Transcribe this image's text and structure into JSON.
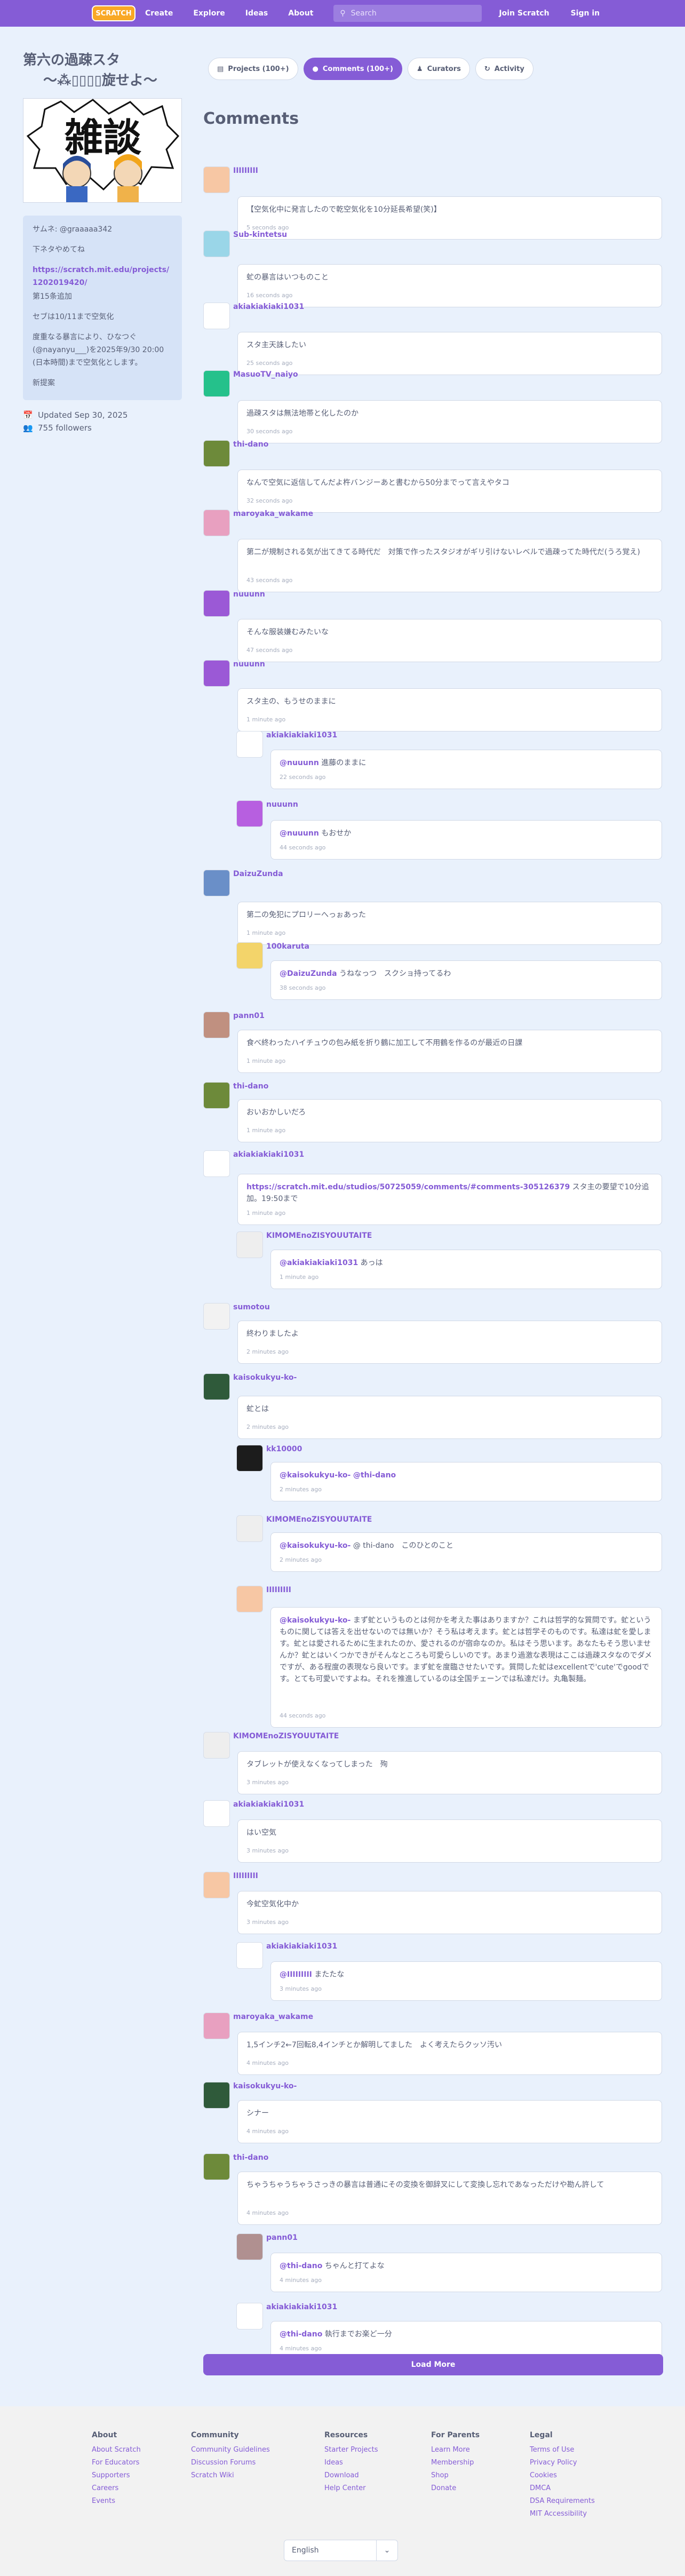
{
  "nav": {
    "logo": "SCRATCH",
    "create": "Create",
    "explore": "Explore",
    "ideas": "Ideas",
    "about": "About",
    "search_placeholder": "Search",
    "join": "Join Scratch",
    "signin": "Sign in"
  },
  "studio": {
    "title_line1": "第六の過疎スタ",
    "title_line2": "〜⁂▯▯▯▯旋せよ〜",
    "thumb_text": "雑談",
    "desc": [
      "サムネ: @graaaaa342",
      "下ネタやめてね",
      "https://scratch.mit.edu/projects/1202019420/",
      "第15条追加",
      "セブは10/11まで空気化",
      "度重なる暴言により、ひなつぐ(@nayanyu___)を2025年9/30 20:00 (日本時間)まで空気化とします。",
      "新提案"
    ],
    "updated": "Updated Sep 30, 2025",
    "followers": "755 followers"
  },
  "tabs": [
    {
      "label": "Projects (100+)",
      "icon": "projects-icon"
    },
    {
      "label": "Comments (100+)",
      "icon": "comments-icon"
    },
    {
      "label": "Curators",
      "icon": "curators-icon"
    },
    {
      "label": "Activity",
      "icon": "activity-icon"
    }
  ],
  "comments_heading": "Comments",
  "comments": [
    {
      "user": "IIIIIIIII",
      "text": "【空気化中に発言したので乾空気化を10分延長希望(笑)】",
      "time": "5 seconds ago",
      "reply": false
    },
    {
      "user": "Sub-kintetsu",
      "text": "虻の暴言はいつものこと",
      "time": "16 seconds ago",
      "reply": false
    },
    {
      "user": "akiakiakiaki1031",
      "text": "スタ主天誅したい",
      "time": "25 seconds ago",
      "reply": false
    },
    {
      "user": "MasuoTV_naiyo",
      "text": "過疎スタは無法地帯と化したのか",
      "time": "30 seconds ago",
      "reply": false
    },
    {
      "user": "thi-dano",
      "text": "なんで空気に返信してんだよ杵バンジーあと書むから50分までって言えやタコ",
      "time": "32 seconds ago",
      "reply": false
    },
    {
      "user": "maroyaka_wakame",
      "text": "第二が規制される気が出てきてる時代だ　対策で作ったスタジオがギリ引けないレベルで過疎ってた時代だ(うろ覚え)",
      "time": "43 seconds ago",
      "reply": false
    },
    {
      "user": "nuuunn",
      "text": "そんな服装嫌むみたいな",
      "time": "47 seconds ago",
      "reply": false
    },
    {
      "user": "nuuunn",
      "text": "スタ主の、もうせのままに",
      "time": "1 minute ago",
      "reply": false
    },
    {
      "user": "akiakiakiaki1031",
      "mention": "@nuuunn",
      "text": " 進藤のままに",
      "time": "22 seconds ago",
      "reply": true
    },
    {
      "user": "nuuunn",
      "mention": "@nuuunn",
      "text": " もおせか",
      "time": "44 seconds ago",
      "reply": true
    },
    {
      "user": "DaizuZunda",
      "text": "第二の免犯にプロリーへっぉあった",
      "time": "1 minute ago",
      "reply": false
    },
    {
      "user": "100karuta",
      "mention": "@DaizuZunda",
      "text": " うねなっつ　スクショ持ってるわ",
      "time": "38 seconds ago",
      "reply": true
    },
    {
      "user": "pann01",
      "text": "食べ終わったハイチュウの包み紙を折り鶴に加工して不用鶴を作るのが最近の日課",
      "time": "1 minute ago",
      "reply": false
    },
    {
      "user": "thi-dano",
      "text": "おいおかしいだろ",
      "time": "1 minute ago",
      "reply": false
    },
    {
      "user": "akiakiakiaki1031",
      "link": "https://scratch.mit.edu/studios/50725059/comments/#comments-305126379",
      "text": " スタ主の要望で10分追加。19:50まで",
      "time": "1 minute ago",
      "reply": false
    },
    {
      "user": "KIMOMEnoZISYOUUTAITE",
      "mention": "@akiakiakiaki1031",
      "text": " あっは",
      "time": "1 minute ago",
      "reply": true
    },
    {
      "user": "sumotou",
      "text": "終わりましたよ",
      "time": "2 minutes ago",
      "reply": false
    },
    {
      "user": "kaisokukyu-ko-",
      "text": "虻とは",
      "time": "2 minutes ago",
      "reply": false
    },
    {
      "user": "kk10000",
      "mention": "@kaisokukyu-ko-",
      "mention2": "@thi-dano",
      "text": "",
      "time": "2 minutes ago",
      "reply": true
    },
    {
      "user": "KIMOMEnoZISYOUUTAITE",
      "mention": "@kaisokukyu-ko-",
      "text": " @ thi-dano　このひとのこと",
      "time": "2 minutes ago",
      "reply": true
    },
    {
      "user": "IIIIIIIII",
      "mention": "@kaisokukyu-ko-",
      "text": " まず虻というものとは何かを考えた事はありますか？これは哲学的な質問です。虻というものに関しては答えを出せないのでは無いか？そう私は考えます。虻とは哲学そのものです。私達は虻を愛します。虻とは愛されるために生まれたのか、愛されるのが宿命なのか。私はそう思います。あなたもそう思いませんか？虻とはいくつかできがそんなところも可愛らしいのです。あまり過激な表現はここは過疎スタなのでダメですが、ある程度の表現なら良いです。まず虻を度臨させたいです。質問した虻はexcellentで'cute'でgoodです。とても可愛いですよね。それを推進しているのは全国チェーンでは私達だけ。丸亀製麺。",
      "time": "44 seconds ago",
      "reply": true
    },
    {
      "user": "KIMOMEnoZISYOUUTAITE",
      "text": "タブレットが使えなくなってしまった　殉",
      "time": "3 minutes ago",
      "reply": false
    },
    {
      "user": "akiakiakiaki1031",
      "text": "はい空気",
      "time": "3 minutes ago",
      "reply": false
    },
    {
      "user": "IIIIIIIII",
      "text": "今虻空気化中か",
      "time": "3 minutes ago",
      "reply": false
    },
    {
      "user": "akiakiakiaki1031",
      "mention": "@IIIIIIIII",
      "text": " またたな",
      "time": "3 minutes ago",
      "reply": true
    },
    {
      "user": "maroyaka_wakame",
      "text": "1,5インチ2←7回転8,4インチとか解明してました　よく考えたらクッソ汚い",
      "time": "4 minutes ago",
      "reply": false
    },
    {
      "user": "kaisokukyu-ko-",
      "text": "シナー",
      "time": "4 minutes ago",
      "reply": false
    },
    {
      "user": "thi-dano",
      "text": "ちゃうちゃうちゃうさっきの暴言は普通にその変換を御辞叉にして変換し忘れであなっただけや勘ん許して",
      "time": "4 minutes ago",
      "reply": false
    },
    {
      "user": "pann01",
      "mention": "@thi-dano",
      "text": " ちゃんと打てよな",
      "time": "4 minutes ago",
      "reply": true
    },
    {
      "user": "akiakiakiaki1031",
      "mention": "@thi-dano",
      "text": " 執行までお楽ど一分",
      "time": "4 minutes ago",
      "reply": true
    }
  ],
  "load_more": "Load More",
  "footer": {
    "cols": [
      {
        "title": "About",
        "items": [
          "About Scratch",
          "For Educators",
          "Supporters",
          "Careers",
          "Events"
        ]
      },
      {
        "title": "Community",
        "items": [
          "Community Guidelines",
          "Discussion Forums",
          "Scratch Wiki"
        ]
      },
      {
        "title": "Resources",
        "items": [
          "Starter Projects",
          "Ideas",
          "Download",
          "Help Center"
        ]
      },
      {
        "title": "For Parents",
        "items": [
          "Learn More",
          "Membership",
          "Shop",
          "Donate"
        ]
      },
      {
        "title": "Legal",
        "items": [
          "Terms of Use",
          "Privacy Policy",
          "Cookies",
          "DMCA",
          "DSA Requirements",
          "MIT Accessibility"
        ]
      }
    ],
    "language": "English"
  }
}
